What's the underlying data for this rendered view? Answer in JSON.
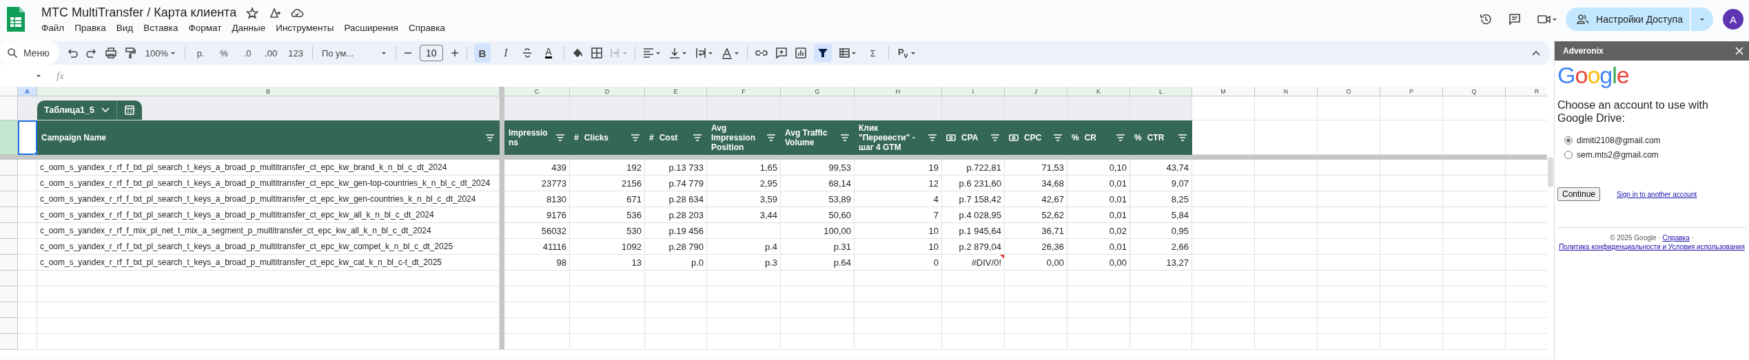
{
  "document": {
    "title": "МТС MultiTransfer / Карта клиента"
  },
  "menu": [
    "Файл",
    "Правка",
    "Вид",
    "Вставка",
    "Формат",
    "Данные",
    "Инструменты",
    "Расширения",
    "Справка"
  ],
  "share_button": {
    "label": "Настройки Доступа"
  },
  "avatar": {
    "initial": "A"
  },
  "toolbar": {
    "search_placeholder": "Меню",
    "zoom": "100%",
    "currency": "р.",
    "percent": "%",
    "decrease_decimals": ".0",
    "increase_decimals": ".00",
    "more_formats": "123",
    "font": "По ум...",
    "font_size": "10",
    "bold": {
      "label": "B",
      "on": true
    },
    "italic": "I",
    "text_color": "A",
    "merge": {
      "disabled": true
    },
    "filter": {
      "on": true
    },
    "functions": "Σ",
    "input_tools": "Р$_{v}$"
  },
  "formula_bar": {
    "fx": "fx"
  },
  "columns": [
    {
      "letter": "A",
      "in_table": true,
      "selected": true
    },
    {
      "letter": "B",
      "in_table": true,
      "selected": false
    },
    {
      "letter": "C",
      "in_table": true,
      "selected": false
    },
    {
      "letter": "D",
      "in_table": true,
      "selected": false
    },
    {
      "letter": "E",
      "in_table": true,
      "selected": false
    },
    {
      "letter": "F",
      "in_table": true,
      "selected": false
    },
    {
      "letter": "G",
      "in_table": true,
      "selected": false
    },
    {
      "letter": "H",
      "in_table": true,
      "selected": false
    },
    {
      "letter": "I",
      "in_table": true,
      "selected": false
    },
    {
      "letter": "J",
      "in_table": true,
      "selected": false
    },
    {
      "letter": "K",
      "in_table": true,
      "selected": false
    },
    {
      "letter": "L",
      "in_table": true,
      "selected": false
    },
    {
      "letter": "M",
      "in_table": false,
      "selected": false
    },
    {
      "letter": "N",
      "in_table": false,
      "selected": false
    },
    {
      "letter": "O",
      "in_table": false,
      "selected": false
    },
    {
      "letter": "P",
      "in_table": false,
      "selected": false
    },
    {
      "letter": "Q",
      "in_table": false,
      "selected": false
    },
    {
      "letter": "R",
      "in_table": false,
      "selected": false
    }
  ],
  "table": {
    "name": "Таблица1_5",
    "headers": [
      {
        "label": "Campaign Name",
        "kind": "text"
      },
      {
        "label": "Impressions",
        "kind": "text"
      },
      {
        "label": "Clicks",
        "kind": "number",
        "mark": "#"
      },
      {
        "label": "Cost",
        "kind": "number",
        "mark": "#"
      },
      {
        "label": "Avg Impression Position",
        "kind": "text"
      },
      {
        "label": "Avg Traffic Volume",
        "kind": "text"
      },
      {
        "label": "Клик \"Перевести\" - шаг 4 GTM",
        "kind": "text"
      },
      {
        "label": "CPA",
        "kind": "currency"
      },
      {
        "label": "CPC",
        "kind": "currency"
      },
      {
        "label": "CR",
        "kind": "percent",
        "mark": "%"
      },
      {
        "label": "CTR",
        "kind": "percent",
        "mark": "%"
      }
    ],
    "rows": [
      {
        "cells": [
          "c_oom_s_yandex_r_rf_f_txt_pl_search_t_keys_a_broad_p_multitransfer_ct_epc_kw_brand_k_n_bl_c_dt_2024",
          "439",
          "192",
          "р.13 733",
          "1,65",
          "99,53",
          "19",
          "р.722,81",
          "71,53",
          "0,10",
          "43,74"
        ],
        "cpa_error": false
      },
      {
        "cells": [
          "c_oom_s_yandex_r_rf_f_txt_pl_search_t_keys_a_broad_p_multitransfer_ct_epc_kw_gen-top-countries_k_n_bl_c_dt_2024",
          "23773",
          "2156",
          "р.74 779",
          "2,95",
          "68,14",
          "12",
          "р.6 231,60",
          "34,68",
          "0,01",
          "9,07"
        ],
        "cpa_error": false
      },
      {
        "cells": [
          "c_oom_s_yandex_r_rf_f_txt_pl_search_t_keys_a_broad_p_multitransfer_ct_epc_kw_gen-countries_k_n_bl_c_dt_2024",
          "8130",
          "671",
          "р.28 634",
          "3,59",
          "53,89",
          "4",
          "р.7 158,42",
          "42,67",
          "0,01",
          "8,25"
        ],
        "cpa_error": false
      },
      {
        "cells": [
          "c_oom_s_yandex_r_rf_f_txt_pl_search_t_keys_a_broad_p_multitransfer_ct_epc_kw_all_k_n_bl_c_dt_2024",
          "9176",
          "536",
          "р.28 203",
          "3,44",
          "50,60",
          "7",
          "р.4 028,95",
          "52,62",
          "0,01",
          "5,84"
        ],
        "cpa_error": false
      },
      {
        "cells": [
          "c_oom_s_yandex_r_rf_f_mix_pl_net_t_mix_a_segment_p_multitransfer_ct_epc_kw_all_k_n_bl_c_dt_2024",
          "56032",
          "530",
          "р.19 456",
          null,
          "100,00",
          "10",
          "р.1 945,64",
          "36,71",
          "0,02",
          "0,95"
        ],
        "cpa_error": false
      },
      {
        "cells": [
          "c_oom_s_yandex_r_rf_f_txt_pl_search_t_keys_a_broad_p_multitransfer_ct_epc_kw_compet_k_n_bl_c_dt_2025",
          "41116",
          "1092",
          "р.28 790",
          "р.4",
          "р.31",
          "10",
          "р.2 879,04",
          "26,36",
          "0,01",
          "2,66"
        ],
        "cpa_error": false
      },
      {
        "cells": [
          "c_oom_s_yandex_r_rf_f_txt_pl_search_t_keys_a_broad_p_multitransfer_ct_epc_kw_cat_k_n_bl_c-t_dt_2025",
          "98",
          "13",
          "р.0",
          "р.3",
          "р.64",
          "0",
          "#DIV/0!",
          "0,00",
          "0,00",
          "13,27"
        ],
        "cpa_error": true
      }
    ]
  },
  "side_panel": {
    "title": "Adveronix",
    "logo": "Google",
    "heading": "Choose an account to use with Google Drive:",
    "accounts": [
      {
        "email": "dimiti2108@gmail.com",
        "selected": true
      },
      {
        "email": "sem.mts2@gmail.com",
        "selected": false
      }
    ],
    "continue_button": "Continue",
    "other_account_link": "Sign in to another account",
    "footer": {
      "copyright": "© 2025 Google",
      "separator": "·",
      "links": [
        "Справка",
        "Политика конфиденциальности и Условия использования"
      ]
    }
  }
}
